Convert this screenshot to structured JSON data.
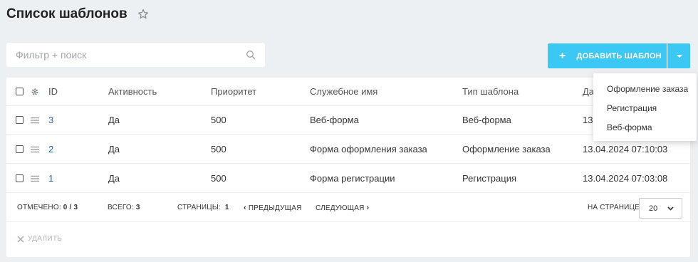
{
  "page": {
    "title": "Список шаблонов"
  },
  "filter": {
    "placeholder": "Фильтр + поиск",
    "value": ""
  },
  "toolbar": {
    "add_label": "ДОБАВИТЬ ШАБЛОН",
    "plus": "+",
    "accent": "#3bc8f5"
  },
  "grid": {
    "columns": [
      "ID",
      "Активность",
      "Приоритет",
      "Служебное имя",
      "Тип шаблона",
      "Да"
    ],
    "rows": [
      {
        "id": "3",
        "active": "Да",
        "priority": "500",
        "name": "Веб-форма",
        "type": "Веб-форма",
        "date": "13"
      },
      {
        "id": "2",
        "active": "Да",
        "priority": "500",
        "name": "Форма оформления заказа",
        "type": "Оформление заказа",
        "date": "13.04.2024 07:10:03"
      },
      {
        "id": "1",
        "active": "Да",
        "priority": "500",
        "name": "Форма регистрации",
        "type": "Регистрация",
        "date": "13.04.2024 07:03:08"
      }
    ]
  },
  "footer": {
    "checked_label": "ОТМЕЧЕНО:",
    "checked_value": "0 / 3",
    "total_label": "ВСЕГО:",
    "total_value": "3",
    "pages_label": "СТРАНИЦЫ:",
    "pages_value": "1",
    "prev_label": "ПРЕДЫДУЩАЯ",
    "next_label": "СЛЕДУЮЩАЯ",
    "per_page_label": "НА СТРАНИЦЕ:",
    "per_page_value": "20",
    "delete_label": "УДАЛИТЬ"
  },
  "add_menu": {
    "items": [
      "Оформление заказа",
      "Регистрация",
      "Веб-форма"
    ]
  }
}
